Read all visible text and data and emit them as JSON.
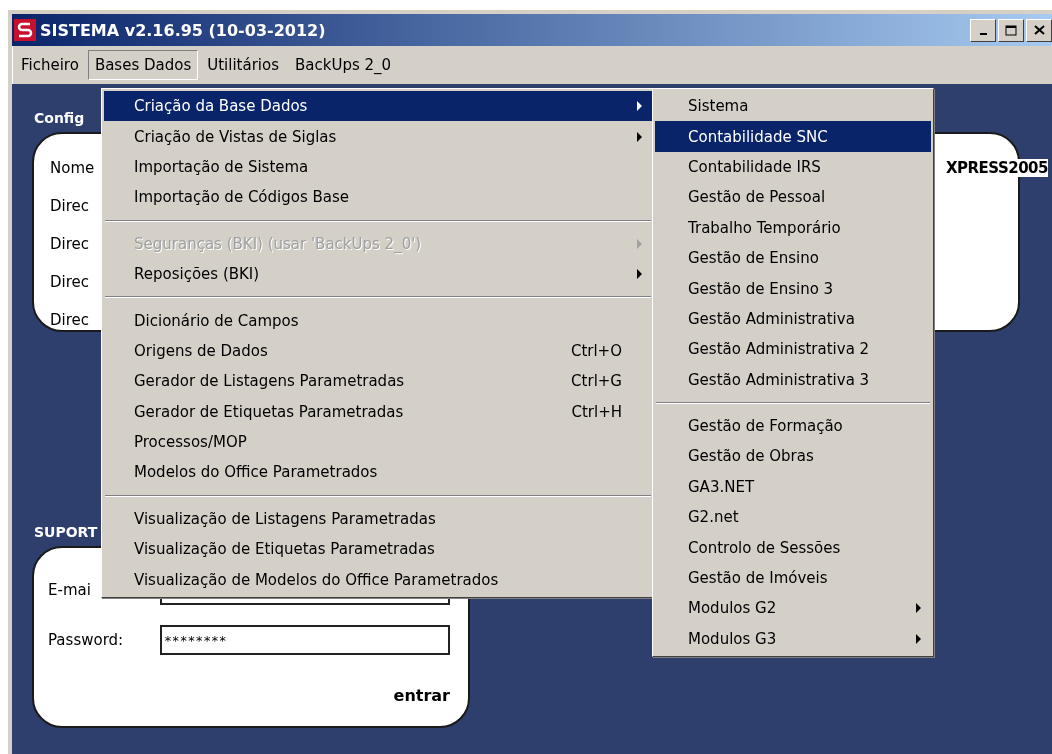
{
  "window": {
    "title": "SISTEMA v2.16.95 (10-03-2012)"
  },
  "menubar": [
    {
      "label": "Ficheiro",
      "selected": false
    },
    {
      "label": "Bases Dados",
      "selected": true
    },
    {
      "label": "Utilitários",
      "selected": false
    },
    {
      "label": "BackUps 2_0",
      "selected": false
    }
  ],
  "config_panel": {
    "heading": "Config",
    "fields": [
      {
        "label": "Nome",
        "value": "XPRESS2005"
      },
      {
        "label": "Direc"
      },
      {
        "label": "Direc"
      },
      {
        "label": "Direc"
      },
      {
        "label": "Direc"
      }
    ]
  },
  "support_panel": {
    "heading": "SUPORT",
    "fields": [
      {
        "label": "E-mai"
      },
      {
        "label": "Password:",
        "value": "********"
      }
    ],
    "button": "entrar"
  },
  "menu": {
    "items": [
      {
        "kind": "item",
        "label": "Criação da Base Dados",
        "selected": true,
        "disabled": false,
        "submenu": true
      },
      {
        "kind": "item",
        "label": "Criação de Vistas de Siglas",
        "selected": false,
        "disabled": false,
        "submenu": true
      },
      {
        "kind": "item",
        "label": "Importação de Sistema",
        "selected": false,
        "disabled": false,
        "submenu": false
      },
      {
        "kind": "item",
        "label": "Importação de Códigos Base",
        "selected": false,
        "disabled": false,
        "submenu": false
      },
      {
        "kind": "separator"
      },
      {
        "kind": "item",
        "label": "Seguranças (BKI) (usar 'BackUps 2_0')",
        "selected": false,
        "disabled": true,
        "submenu": true
      },
      {
        "kind": "item",
        "label": "Reposições (BKI)",
        "selected": false,
        "disabled": false,
        "submenu": true
      },
      {
        "kind": "separator"
      },
      {
        "kind": "item",
        "label": "Dicionário de Campos",
        "selected": false,
        "disabled": false,
        "submenu": false
      },
      {
        "kind": "item",
        "label": "Origens de Dados",
        "selected": false,
        "disabled": false,
        "submenu": false,
        "shortcut": "Ctrl+O"
      },
      {
        "kind": "item",
        "label": "Gerador de Listagens Parametradas",
        "selected": false,
        "disabled": false,
        "submenu": false,
        "shortcut": "Ctrl+G"
      },
      {
        "kind": "item",
        "label": "Gerador de Etiquetas Parametradas",
        "selected": false,
        "disabled": false,
        "submenu": false,
        "shortcut": "Ctrl+H"
      },
      {
        "kind": "item",
        "label": "Processos/MOP",
        "selected": false,
        "disabled": false,
        "submenu": false
      },
      {
        "kind": "item",
        "label": "Modelos do Office Parametrados",
        "selected": false,
        "disabled": false,
        "submenu": false
      },
      {
        "kind": "separator"
      },
      {
        "kind": "item",
        "label": "Visualização de Listagens Parametradas",
        "selected": false,
        "disabled": false,
        "submenu": false
      },
      {
        "kind": "item",
        "label": "Visualização de Etiquetas Parametradas",
        "selected": false,
        "disabled": false,
        "submenu": false
      },
      {
        "kind": "item",
        "label": "Visualização de Modelos do Office Parametrados",
        "selected": false,
        "disabled": false,
        "submenu": false
      }
    ]
  },
  "submenu": {
    "items": [
      {
        "kind": "item",
        "label": "Sistema",
        "selected": false,
        "disabled": false,
        "submenu": false
      },
      {
        "kind": "item",
        "label": "Contabilidade SNC",
        "selected": true,
        "disabled": false,
        "submenu": false
      },
      {
        "kind": "item",
        "label": "Contabilidade IRS",
        "selected": false,
        "disabled": false,
        "submenu": false
      },
      {
        "kind": "item",
        "label": "Gestão de Pessoal",
        "selected": false,
        "disabled": false,
        "submenu": false
      },
      {
        "kind": "item",
        "label": "Trabalho Temporário",
        "selected": false,
        "disabled": false,
        "submenu": false
      },
      {
        "kind": "item",
        "label": "Gestão de Ensino",
        "selected": false,
        "disabled": false,
        "submenu": false
      },
      {
        "kind": "item",
        "label": "Gestão de Ensino 3",
        "selected": false,
        "disabled": false,
        "submenu": false
      },
      {
        "kind": "item",
        "label": "Gestão Administrativa",
        "selected": false,
        "disabled": false,
        "submenu": false
      },
      {
        "kind": "item",
        "label": "Gestão Administrativa 2",
        "selected": false,
        "disabled": false,
        "submenu": false
      },
      {
        "kind": "item",
        "label": "Gestão Administrativa 3",
        "selected": false,
        "disabled": false,
        "submenu": false
      },
      {
        "kind": "separator"
      },
      {
        "kind": "item",
        "label": "Gestão de Formação",
        "selected": false,
        "disabled": false,
        "submenu": false
      },
      {
        "kind": "item",
        "label": "Gestão de Obras",
        "selected": false,
        "disabled": false,
        "submenu": false
      },
      {
        "kind": "item",
        "label": "GA3.NET",
        "selected": false,
        "disabled": false,
        "submenu": false
      },
      {
        "kind": "item",
        "label": "G2.net",
        "selected": false,
        "disabled": false,
        "submenu": false
      },
      {
        "kind": "item",
        "label": "Controlo de Sessões",
        "selected": false,
        "disabled": false,
        "submenu": false
      },
      {
        "kind": "item",
        "label": "Gestão de Imóveis",
        "selected": false,
        "disabled": false,
        "submenu": false
      },
      {
        "kind": "item",
        "label": "Modulos G2",
        "selected": false,
        "disabled": false,
        "submenu": true
      },
      {
        "kind": "item",
        "label": "Modulos G3",
        "selected": false,
        "disabled": false,
        "submenu": true
      }
    ]
  }
}
